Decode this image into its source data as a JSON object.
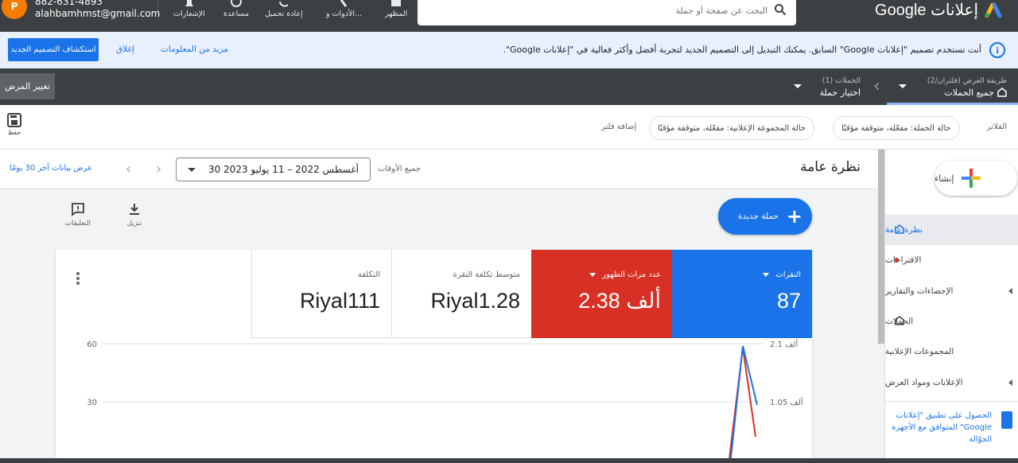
{
  "topbar": {
    "brand": "إعلانات Google",
    "search_placeholder": "البحث عن صفحة أو حملة",
    "appearance": "المظهر",
    "tools": "الأدوات و...",
    "reload": "إعادة تحميل",
    "help": "مساعدة",
    "notifications": "الإشعارات",
    "account_id": "882-631-4893",
    "account_email": "alahbamhmst@gmail.com",
    "avatar_letter": "P"
  },
  "banner": {
    "message": "أنت تستخدم تصميم \"إعلانات Google\" السابق. يمكنك التبديل إلى التصميم الجديد لتجربة أفضل وأكثر فعالية في \"إعلانات Google\".",
    "more_info": "مزيد من المعلومات",
    "close": "إغلاق",
    "explore": "استكشاف التصميم الجديد"
  },
  "navbar": {
    "view_small": "طريقة العرض (فلتران/2)",
    "view_big": "جميع الحملات",
    "campaigns_small": "الحملات (1)",
    "campaigns_big": "اختيار حملة",
    "change_view": "تغيير المرض"
  },
  "filters": {
    "label": "الفلاتر",
    "chip1": "حالة الحملة: مفعّلة، متوقفة مؤقتًا",
    "chip2": "حالة المجموعة الإعلانية: مفعّلة، متوقفة مؤقتًا",
    "add": "إضافة فلتر",
    "save": "حفظ"
  },
  "sidebar": {
    "create": "إنشاء",
    "items": [
      {
        "label": "نظرة عامة"
      },
      {
        "label": "الاقتراحات"
      },
      {
        "label": "الإحصاءات والتقارير"
      },
      {
        "label": "الحملات"
      },
      {
        "label": "المجموعات الإعلانية"
      },
      {
        "label": "الإعلانات ومواد العرض"
      }
    ],
    "mobile_promo": "الحصول على تطبيق \"إعلانات Google\" المتوافق مع الأجهزة الجوّالة"
  },
  "main": {
    "title": "نظرة عامة",
    "all_time": "جميع الأوقات",
    "date_range": "30 أغسطس 2022 – 11 يوليو 2023",
    "last30": "عرض بيانات آخر 30 يومًا",
    "new_campaign": "حملة جديدة",
    "download": "تنزيل",
    "feedback": "التعليقات"
  },
  "metrics": [
    {
      "label": "النقرات",
      "value": "87"
    },
    {
      "label": "عدد مرات الظهور",
      "value": "2.38 ألف"
    },
    {
      "label": "متوسط تكلفة النقرة",
      "value": "Riyal1.28"
    },
    {
      "label": "التكلفة",
      "value": "Riyal111"
    }
  ],
  "chart_data": {
    "type": "line",
    "left_axis_ticks": [
      "60",
      "30"
    ],
    "right_axis_ticks": [
      "2.1 ألف",
      "1.05 ألف"
    ],
    "colors": {
      "clicks": "#1a73e8",
      "impressions": "#d93025"
    }
  },
  "colors": {
    "accent": "#1a73e8",
    "red": "#d93025",
    "dark": "#3c4043"
  }
}
